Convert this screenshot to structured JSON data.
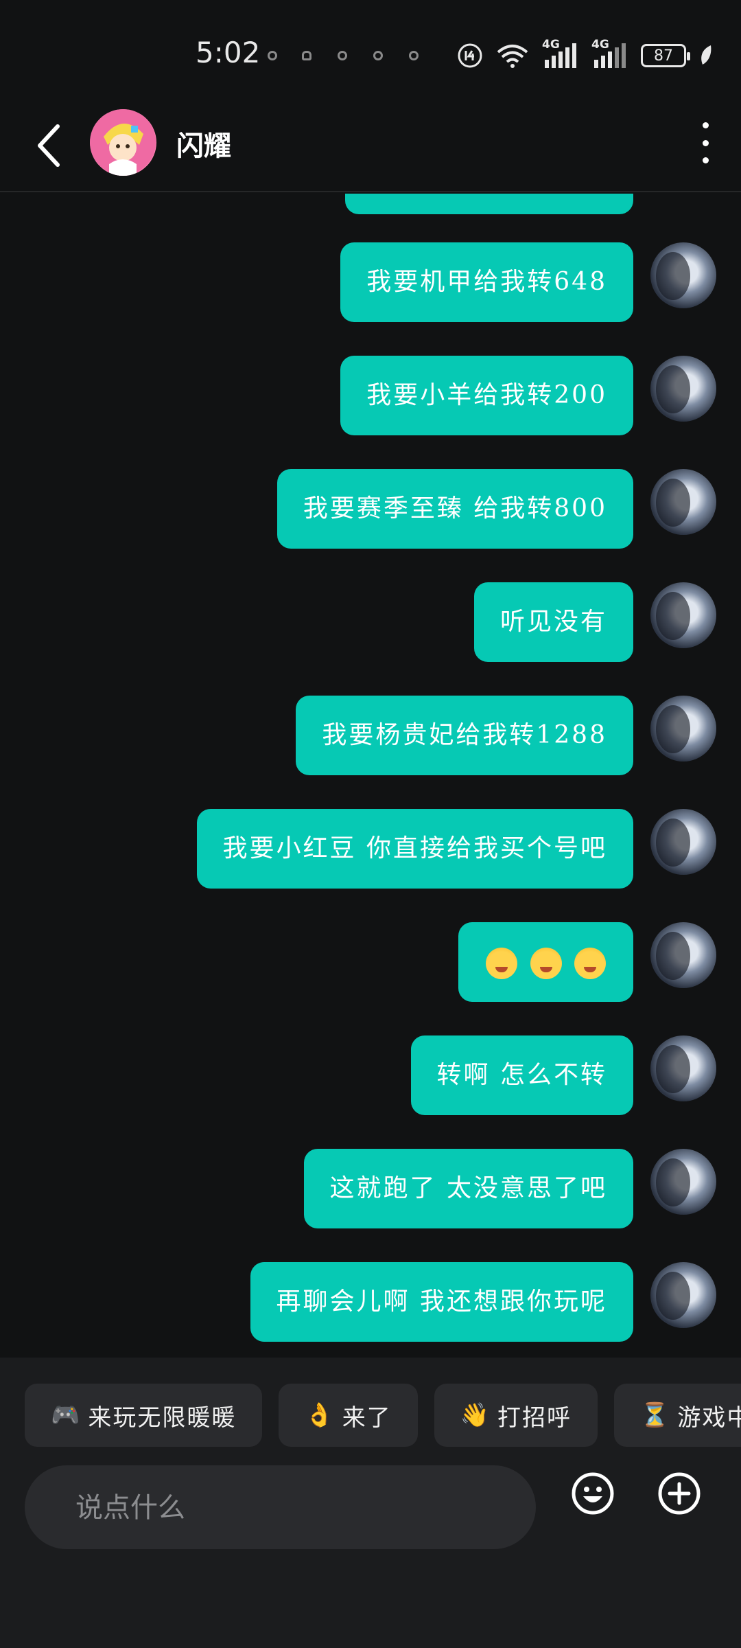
{
  "status_bar": {
    "time": "5:02",
    "network_1": "4G",
    "network_2": "4G",
    "battery": "87"
  },
  "header": {
    "title": "闪耀"
  },
  "messages": [
    {
      "text": "我要机甲给我转648"
    },
    {
      "text": "我要小羊给我转200"
    },
    {
      "text": "我要赛季至臻 给我转800"
    },
    {
      "text": "听见没有"
    },
    {
      "text": "我要杨贵妃给我转1288"
    },
    {
      "text": "我要小红豆 你直接给我买个号吧"
    },
    {
      "text": "",
      "emoji_count": 3
    },
    {
      "text": "转啊 怎么不转"
    },
    {
      "text": "这就跑了 太没意思了吧"
    },
    {
      "text": "再聊会儿啊 我还想跟你玩呢"
    }
  ],
  "quick_replies": [
    {
      "icon": "🎮",
      "label": "来玩无限暖暖"
    },
    {
      "icon": "👌",
      "label": "来了"
    },
    {
      "icon": "👋",
      "label": "打招呼"
    },
    {
      "icon": "⏳",
      "label": "游戏中稍"
    }
  ],
  "input": {
    "placeholder": "说点什么"
  },
  "colors": {
    "bubble": "#06c9b4",
    "background": "#111213",
    "panel": "#1b1c1e"
  }
}
